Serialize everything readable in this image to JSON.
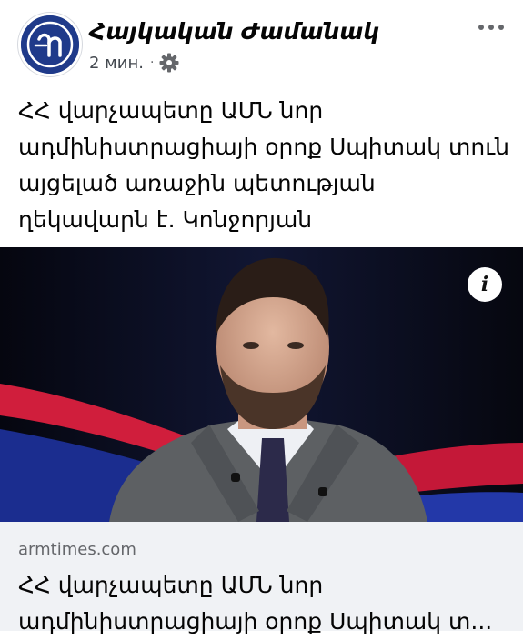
{
  "post": {
    "page_name": "Հայկական Ժամանակ",
    "timestamp": "2 мин.",
    "meta_separator": "·",
    "privacy_icon": "gear-icon",
    "more_icon": "more-icon",
    "text": "ՀՀ վարչապետը ԱՄՆ նոր ադմինիստրացիայի օրոք Սպիտակ տուն այցելած առաջին պետության ղեկավարն է. Կոնջորյան"
  },
  "link_preview": {
    "info_icon": "info-icon",
    "info_label": "i",
    "domain": "armtimes.com",
    "title_line1": "ՀՀ վարչապետը ԱՄՆ նոր",
    "title_line2": "ադմինիստրացիայի օրոք Սպիտակ տ..."
  },
  "colors": {
    "avatar_bg": "#1f3a8a",
    "footer_bg": "#f0f2f5",
    "meta_text": "#65676b",
    "studio_red": "#d01e3c",
    "studio_blue": "#1b2d8f"
  }
}
